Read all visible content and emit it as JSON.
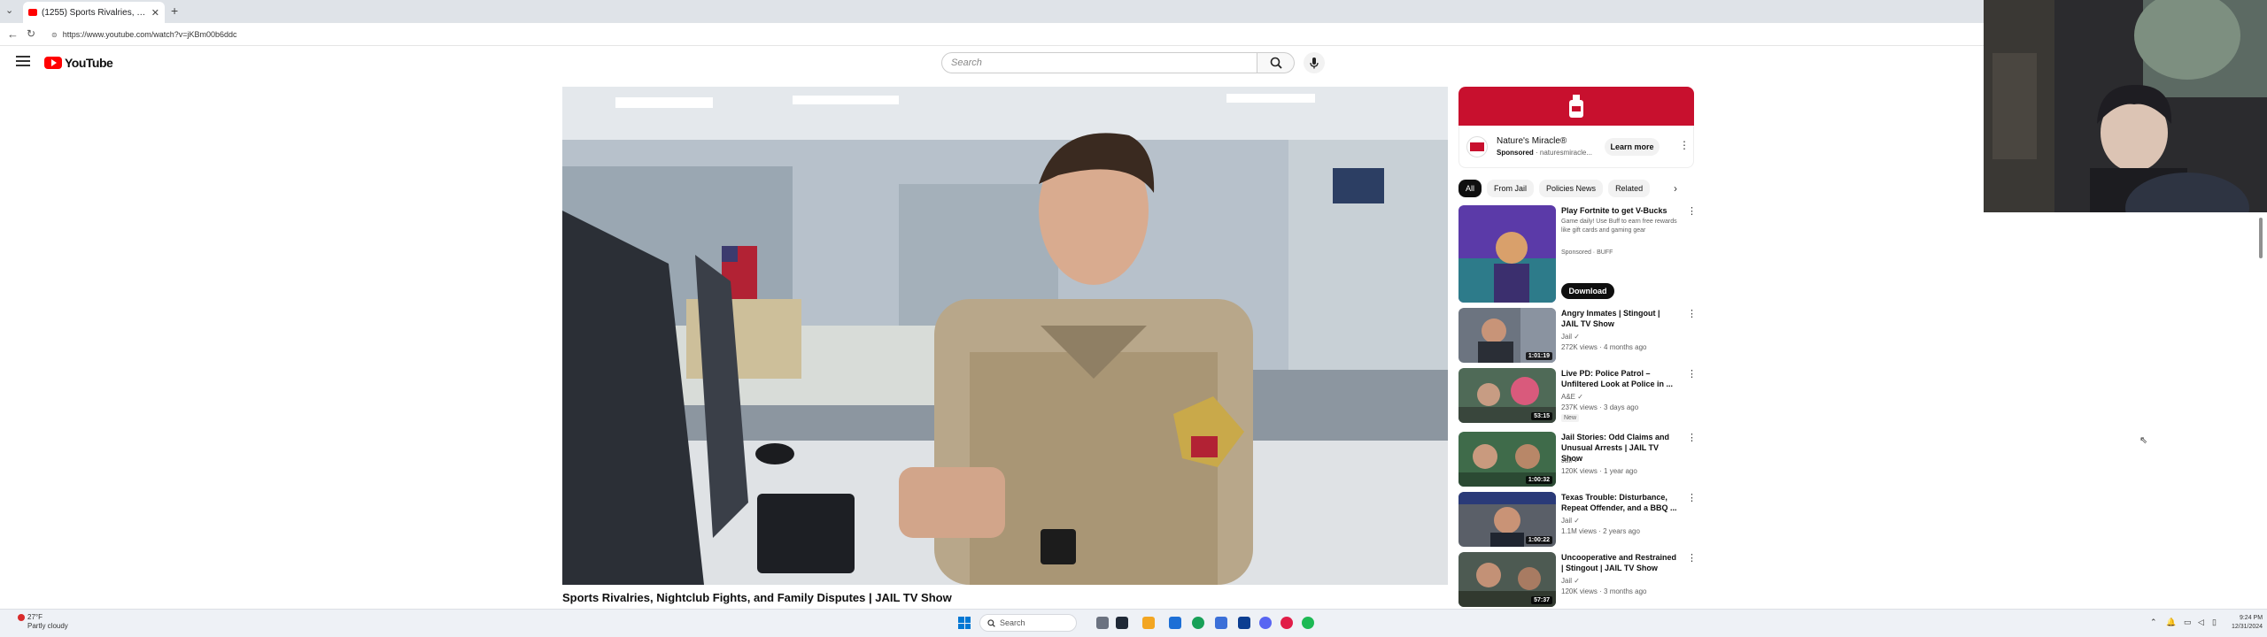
{
  "browser": {
    "tab_title": "(1255) Sports Rivalries, Nightc",
    "new_tab": "+",
    "url": "https://www.youtube.com/watch?v=jKBm00b6ddc"
  },
  "youtube": {
    "logo_text": "YouTube",
    "search_placeholder": "Search"
  },
  "video": {
    "title": "Sports Rivalries, Nightclub Fights, and Family Disputes | JAIL TV Show"
  },
  "ad": {
    "advertiser": "Nature's Miracle®",
    "sponsored": "Sponsored",
    "domain": "naturesmiracle...",
    "cta": "Learn more"
  },
  "chips": [
    "All",
    "From Jail",
    "Policies News",
    "Related"
  ],
  "recommendations": [
    {
      "title": "Play Fortnite to get V-Bucks",
      "desc": "Game daily! Use Buff to earn free rewards like gift cards and gaming gear",
      "channel": "Sponsored · BUFF",
      "cta": "Download"
    },
    {
      "title": "Angry Inmates | Stingout | JAIL TV Show",
      "channel": "Jail ✓",
      "meta": "272K views · 4 months ago",
      "duration": "1:01:19"
    },
    {
      "title": "Live PD: Police Patrol – Unfiltered Look at Police in ...",
      "channel": "A&E ✓",
      "meta": "237K views · 3 days ago",
      "badge": "New",
      "duration": "53:15"
    },
    {
      "title": "Jail Stories: Odd Claims and Unusual Arrests | JAIL TV Show",
      "channel": "Jail ✓",
      "meta": "120K views · 1 year ago",
      "duration": "1:00:32"
    },
    {
      "title": "Texas Trouble: Disturbance, Repeat Offender, and a BBQ ...",
      "channel": "Jail ✓",
      "meta": "1.1M views · 2 years ago",
      "duration": "1:00:22"
    },
    {
      "title": "Uncooperative and Restrained | Stingout | JAIL TV Show",
      "channel": "Jail ✓",
      "meta": "120K views · 3 months ago",
      "duration": "57:37"
    }
  ],
  "taskbar": {
    "weather_temp": "27°F",
    "weather_desc": "Partly cloudy",
    "search": "Search",
    "time": "9:24 PM",
    "date": "12/31/2024"
  },
  "colors": {
    "yt_red": "#ff0000",
    "ad_red": "#c8102e",
    "chip_active": "#0f0f0f"
  }
}
